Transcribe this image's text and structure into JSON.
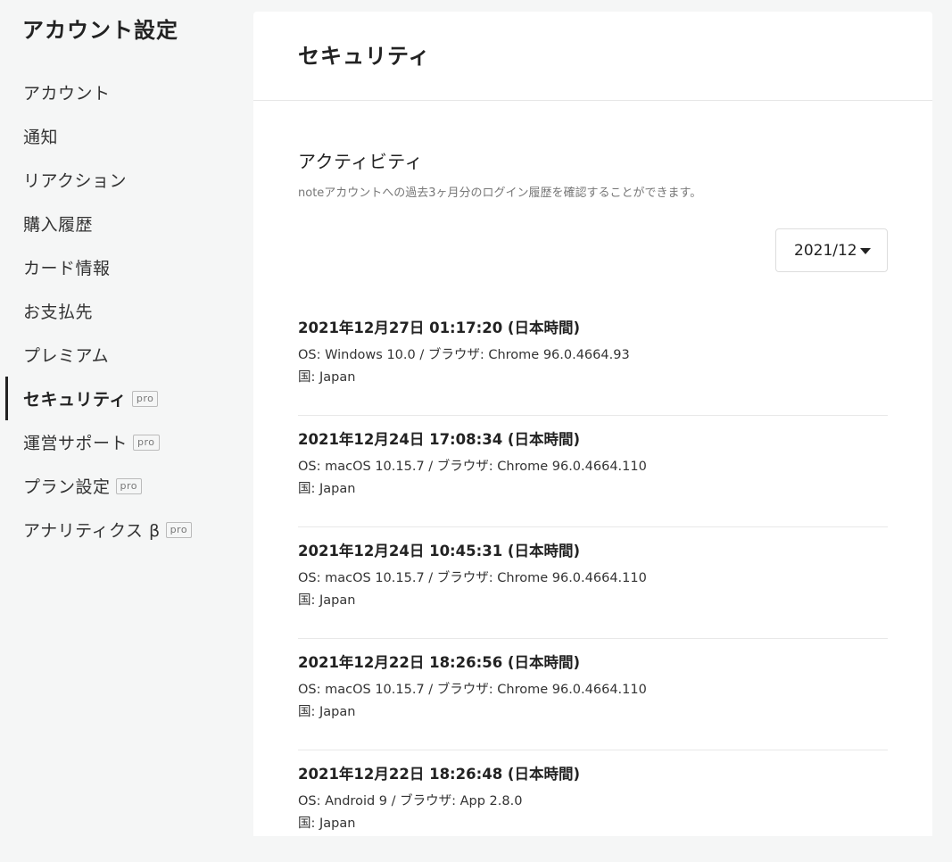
{
  "sidebar": {
    "title": "アカウント設定",
    "items": [
      {
        "label": "アカウント",
        "pro": false,
        "active": false
      },
      {
        "label": "通知",
        "pro": false,
        "active": false
      },
      {
        "label": "リアクション",
        "pro": false,
        "active": false
      },
      {
        "label": "購入履歴",
        "pro": false,
        "active": false
      },
      {
        "label": "カード情報",
        "pro": false,
        "active": false
      },
      {
        "label": "お支払先",
        "pro": false,
        "active": false
      },
      {
        "label": "プレミアム",
        "pro": false,
        "active": false
      },
      {
        "label": "セキュリティ",
        "pro": true,
        "active": true
      },
      {
        "label": "運営サポート",
        "pro": true,
        "active": false
      },
      {
        "label": "プラン設定",
        "pro": true,
        "active": false
      },
      {
        "label": "アナリティクス β",
        "pro": true,
        "active": false
      }
    ],
    "pro_label": "pro"
  },
  "main": {
    "title": "セキュリティ",
    "section_title": "アクティビティ",
    "section_desc": "noteアカウントへの過去3ヶ月分のログイン履歴を確認することができます。",
    "month_select": {
      "value": "2021/12",
      "icon": "caret-down-icon"
    },
    "logins": [
      {
        "date": "2021年12月27日 01:17:20 (日本時間)",
        "os": "OS: Windows 10.0 / ブラウザ: Chrome 96.0.4664.93",
        "country": "国: Japan"
      },
      {
        "date": "2021年12月24日 17:08:34 (日本時間)",
        "os": "OS: macOS 10.15.7 / ブラウザ: Chrome 96.0.4664.110",
        "country": "国: Japan"
      },
      {
        "date": "2021年12月24日 10:45:31 (日本時間)",
        "os": "OS: macOS 10.15.7 / ブラウザ: Chrome 96.0.4664.110",
        "country": "国: Japan"
      },
      {
        "date": "2021年12月22日 18:26:56 (日本時間)",
        "os": "OS: macOS 10.15.7 / ブラウザ: Chrome 96.0.4664.110",
        "country": "国: Japan"
      },
      {
        "date": "2021年12月22日 18:26:48 (日本時間)",
        "os": "OS: Android 9 / ブラウザ: App 2.8.0",
        "country": "国: Japan"
      }
    ]
  }
}
